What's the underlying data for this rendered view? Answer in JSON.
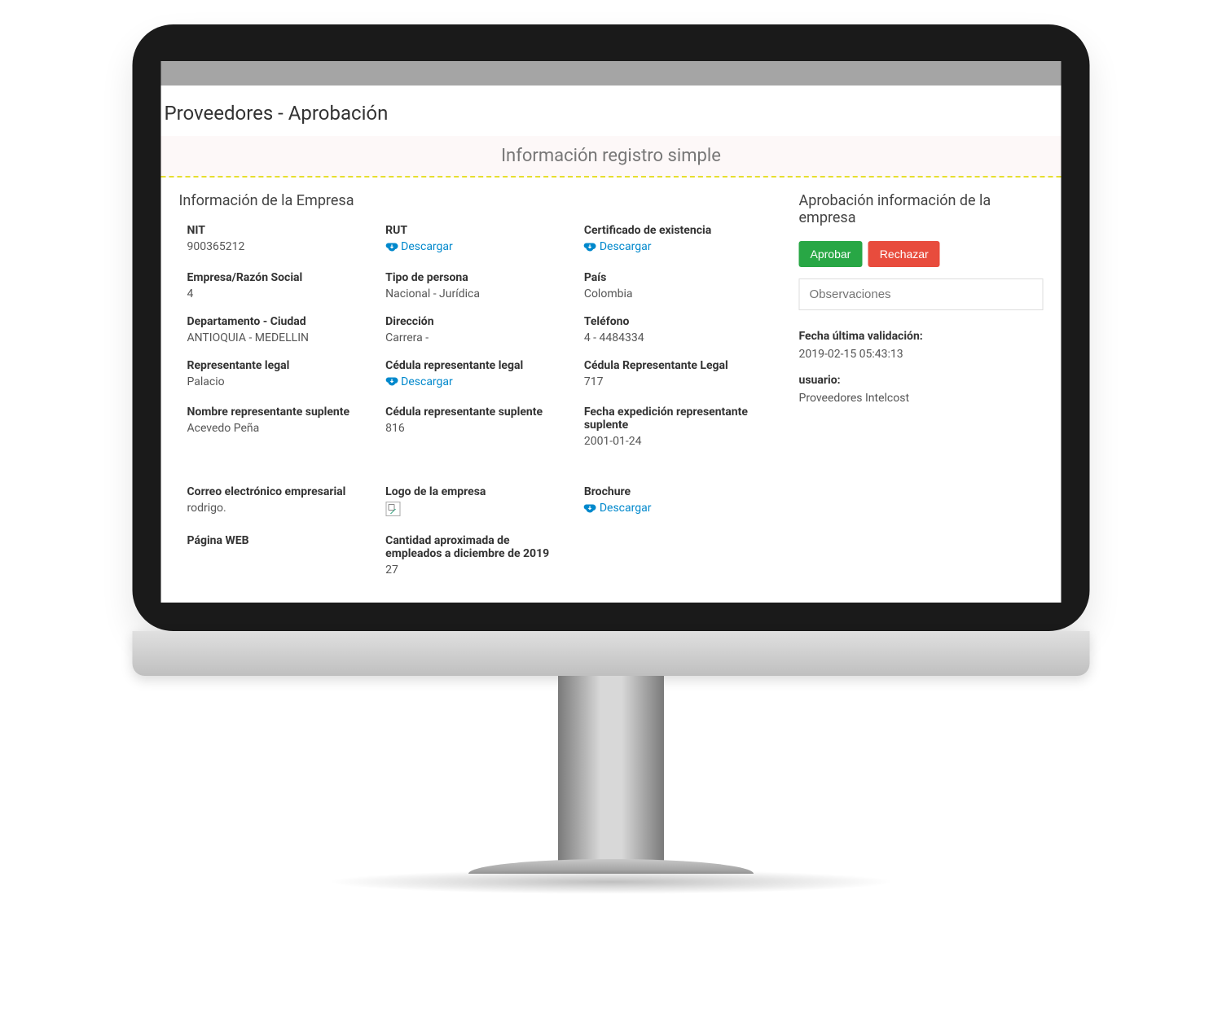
{
  "page_title": "Proveedores - Aprobación",
  "banner_title": "Información registro simple",
  "left_section_title": "Información de la Empresa",
  "right_section_title": "Aprobación información de la empresa",
  "download_label": "Descargar",
  "fields": {
    "nit": {
      "label": "NIT",
      "value": "900365212"
    },
    "rut": {
      "label": "RUT"
    },
    "cert_exist": {
      "label": "Certificado de existencia"
    },
    "empresa": {
      "label": "Empresa/Razón Social",
      "value": "4"
    },
    "tipo_persona": {
      "label": "Tipo de persona",
      "value": "Nacional - Jurídica"
    },
    "pais": {
      "label": "País",
      "value": "Colombia"
    },
    "depto": {
      "label": "Departamento - Ciudad",
      "value": "ANTIOQUIA - MEDELLIN"
    },
    "direccion": {
      "label": "Dirección",
      "value": "Carrera -"
    },
    "telefono": {
      "label": "Teléfono",
      "value": "4 - 4484334"
    },
    "rep_legal": {
      "label": "Representante legal",
      "value": "Palacio"
    },
    "ced_rep_legal": {
      "label": "Cédula representante legal"
    },
    "ced_rep_legal_num": {
      "label": "Cédula Representante Legal",
      "value": "717"
    },
    "rep_suplente": {
      "label": "Nombre representante suplente",
      "value": "Acevedo Peña"
    },
    "ced_rep_suplente": {
      "label": "Cédula representante suplente",
      "value": "816"
    },
    "fecha_exp_suplente": {
      "label": "Fecha expedición representante suplente",
      "value": "2001-01-24"
    },
    "correo": {
      "label": "Correo electrónico empresarial",
      "value": "rodrigo."
    },
    "logo": {
      "label": "Logo de la empresa"
    },
    "brochure": {
      "label": "Brochure"
    },
    "pagina_web": {
      "label": "Página WEB",
      "value": ""
    },
    "empleados": {
      "label": "Cantidad aproximada de empleados a diciembre de 2019",
      "value": "27"
    }
  },
  "approval": {
    "approve_label": "Aprobar",
    "reject_label": "Rechazar",
    "obs_placeholder": "Observaciones",
    "fecha_label": "Fecha última validación:",
    "fecha_value": "2019-02-15 05:43:13",
    "usuario_label": "usuario:",
    "usuario_value": "Proveedores Intelcost"
  }
}
